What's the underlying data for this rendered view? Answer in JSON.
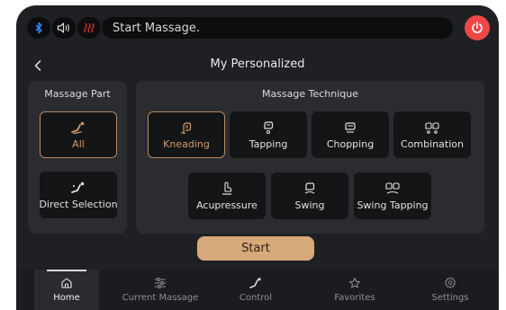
{
  "topbar": {
    "icons": [
      "bluetooth-icon",
      "speaker-icon",
      "heat-icon",
      "power-icon"
    ],
    "message": "Start Massage.",
    "colors": {
      "bluetooth": "#2f8df5",
      "heat": "#d9382e",
      "power": "#ef4646"
    }
  },
  "header": {
    "title": "My Personalized",
    "back_icon": "chevron-left-icon"
  },
  "massage_part": {
    "title": "Massage Part",
    "options": [
      {
        "label": "All",
        "icon": "all-body-icon",
        "selected": true
      },
      {
        "label": "Direct Selection",
        "icon": "direct-selection-icon",
        "selected": false
      }
    ]
  },
  "massage_technique": {
    "title": "Massage Technique",
    "options": [
      {
        "label": "Kneading",
        "icon": "kneading-hand-icon",
        "selected": true
      },
      {
        "label": "Tapping",
        "icon": "tapping-hand-icon",
        "selected": false
      },
      {
        "label": "Chopping",
        "icon": "chopping-hand-icon",
        "selected": false
      },
      {
        "label": "Combination",
        "icon": "combination-hand-icon",
        "selected": false
      },
      {
        "label": "Acupressure",
        "icon": "acupressure-hand-icon",
        "selected": false
      },
      {
        "label": "Swing",
        "icon": "swing-hand-icon",
        "selected": false
      },
      {
        "label": "Swing Tapping",
        "icon": "swing-tapping-hand-icon",
        "selected": false
      }
    ]
  },
  "start_label": "Start",
  "nav": {
    "items": [
      {
        "label": "Home",
        "icon": "home-icon",
        "active": true
      },
      {
        "label": "Current Massage",
        "icon": "sliders-icon",
        "active": false
      },
      {
        "label": "Control",
        "icon": "control-icon",
        "active": false
      },
      {
        "label": "Favorites",
        "icon": "star-icon",
        "active": false
      },
      {
        "label": "Settings",
        "icon": "gear-icon",
        "active": false
      }
    ]
  },
  "accent_color": "#d7a97a"
}
